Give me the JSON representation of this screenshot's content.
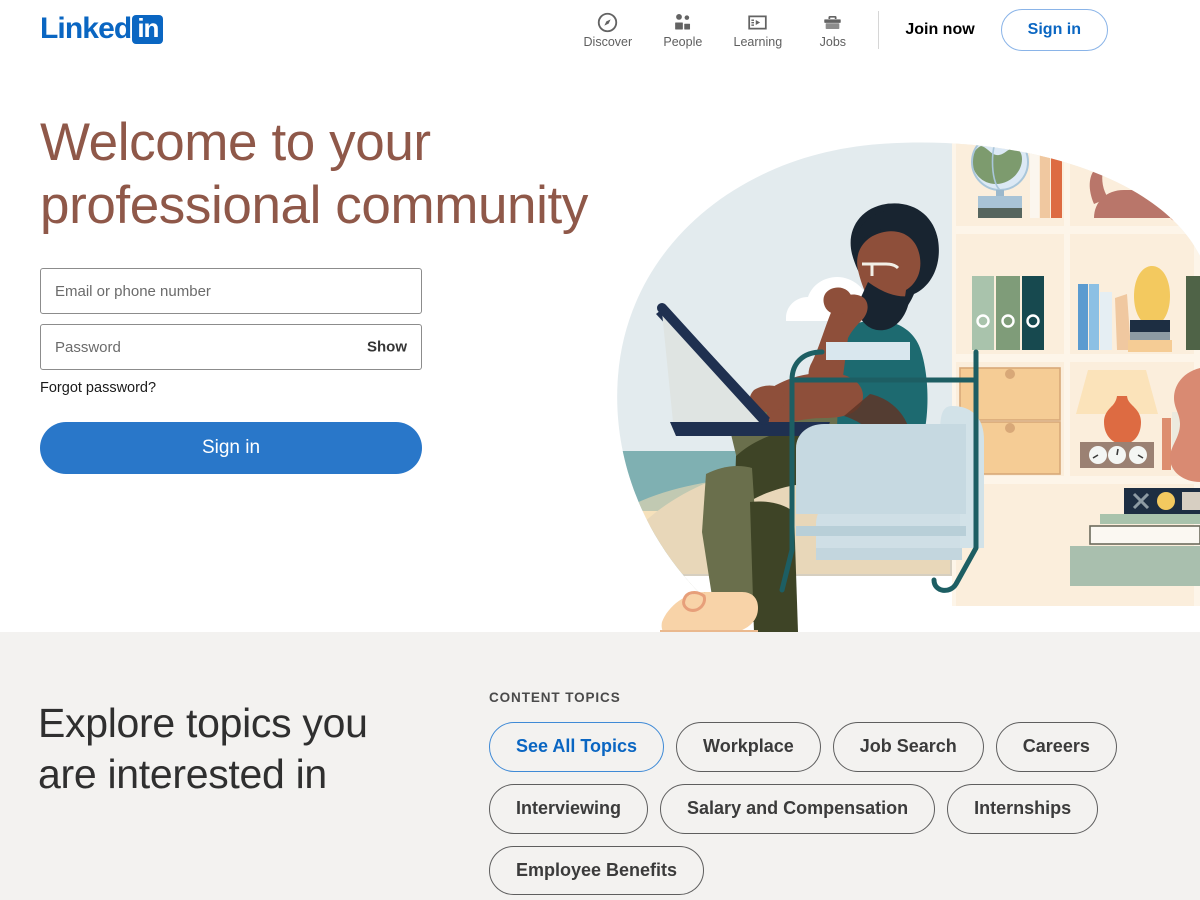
{
  "brand": {
    "name_main": "Linked",
    "name_box": "in",
    "color_primary": "#0a66c2",
    "color_headline": "#8f5849",
    "color_button": "#2977c9",
    "color_section_bg": "#f3f2f0"
  },
  "header": {
    "nav": [
      {
        "label": "Discover",
        "icon": "compass-icon"
      },
      {
        "label": "People",
        "icon": "people-icon"
      },
      {
        "label": "Learning",
        "icon": "learning-screen-icon"
      },
      {
        "label": "Jobs",
        "icon": "briefcase-icon"
      }
    ],
    "join_now_label": "Join now",
    "sign_in_label": "Sign in"
  },
  "hero": {
    "headline_line1": "Welcome to your",
    "headline_line2": "professional community",
    "form": {
      "email_placeholder": "Email or phone number",
      "email_value": "",
      "password_placeholder": "Password",
      "password_value": "",
      "show_label": "Show",
      "forgot_label": "Forgot password?",
      "submit_label": "Sign in"
    }
  },
  "topics": {
    "headline_line1": "Explore topics you",
    "headline_line2": "are interested in",
    "eyebrow": "CONTENT TOPICS",
    "pills": [
      {
        "label": "See All Topics",
        "accent": true
      },
      {
        "label": "Workplace",
        "accent": false
      },
      {
        "label": "Job Search",
        "accent": false
      },
      {
        "label": "Careers",
        "accent": false
      },
      {
        "label": "Interviewing",
        "accent": false
      },
      {
        "label": "Salary and Compensation",
        "accent": false
      },
      {
        "label": "Internships",
        "accent": false
      },
      {
        "label": "Employee Benefits",
        "accent": false
      }
    ]
  },
  "illustration": {
    "description": "person-with-laptop-in-armchair-illustration",
    "colors": {
      "sky": "#e3ebee",
      "water": "#7fb0b2",
      "sand": "#f6e6c8",
      "ground": "#d6cfc0",
      "shelf_bg": "#fbeedc",
      "shelf_light": "#fdf5e9",
      "shirt": "#1d6a70",
      "pants": "#6a6f4c",
      "pants_dark": "#3e4426",
      "skin": "#8e4f3a",
      "hair": "#182430",
      "shoe": "#f8d3a8",
      "chair": "#d2e2e8",
      "chair_frame": "#1d5e63",
      "laptop": "#1f3050",
      "globe_green": "#7d9b6e",
      "cat": "#b9766a",
      "lamp": "#fbe3ba",
      "vase": "#dd6b42",
      "guitar": "#d98a72"
    }
  }
}
